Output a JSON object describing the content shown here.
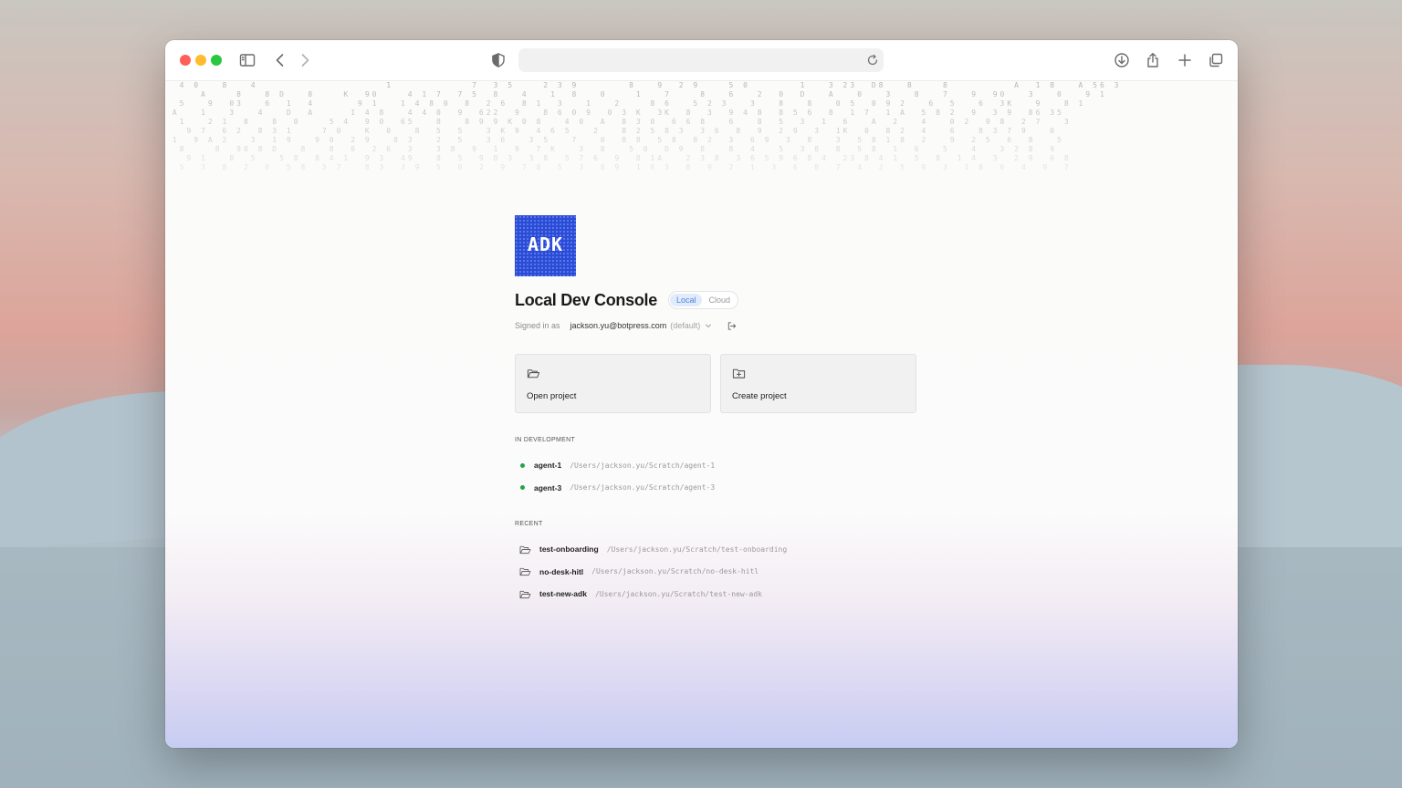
{
  "browser": {
    "url_value": "",
    "url_placeholder": ""
  },
  "background_digits": "  4 0   8   4                  1           7  3 5    2 3 9       8   9  2 9    5 0       1   3 23  D8   8    8         A  1 8   A 56 3\n     A    8   8 D   8    K  90    4 1 7  7 5  8   4   1  8   0    1   7    8   6   2  0  D   A   0   3   8   7   9  90   3   0   9 1\n  5   9  03   6  1  4      9 1   1 4 8 0  8  2 6  8 1  3   1   2    8 6   5 2 3   3   8   8   0 5  0 9 2   6  5   6  3K   9   8 1\n A   1   3   4   D  A     1 4 8   4 4 0  9  622  9   8 6 0 9  0 3 K  3K  8  3  9 4 8  8 5 6  8  1 7  1 A  5 8 2  9  3 9  86 35\n  1   2 1  8   8  0    5 4  9 0  65   8   8 9 9 K 0 8   4 0  A  8 3 0  6 6 8   6   8  5  3  1  6   A  2   4   0 2  9 8  2 7   3\n   9 7  6 2  8 3 1    7 0   K  0   8  5  5   3 K 9  4 6 5   2   8 2 5 8 3  3 6  8  9  2 9  3  1K  0  8 2  4   6   8 3 7 9   0\n 1  9 A 2   3  1 9   9 0  2 9   8 3   2  5   3 6   3 5   7   0  8 8  5 8  8 2  3  6 9  3  8   3  5 8 1 8  2   9  2 5  6  8   5\n  8    8  90 8 D   8   8  0  2 6  3   3 8  9  1  9  7 K   3  8   5 0  D 9  8   8  4   5  3 8  8  5 8  1  6   5   4   3 2 8  9\n   9 1   8  5   5 8  8 4 1  9 3  49   8  5  9 8 3  3 8  5 7 6  9  8 1A   2 3 8  3 6 5 9 6 8 4  23 8 4 1  5  8  1 4  3  2 9  6 8\n  5  3  8  2  0  5 8  5 7   8 3  3 9  5  0  2  9  7 8  5  3  8 9  1 6 3  8  9  2  1  3  6  8  7  4  2  5  9  3  1 8  6  4  9  7",
  "logo": {
    "text": "ADK",
    "bg_color": "#2a4cd6"
  },
  "header": {
    "title": "Local Dev Console",
    "env_options": [
      "Local",
      "Cloud"
    ],
    "env_selected": "Local"
  },
  "account": {
    "signed_in_label": "Signed in as",
    "email": "jackson.yu@botpress.com",
    "tag": "(default)"
  },
  "actions": {
    "open_label": "Open project",
    "create_label": "Create project"
  },
  "in_development": {
    "label": "IN DEVELOPMENT",
    "items": [
      {
        "name": "agent-1",
        "path": "/Users/jackson.yu/Scratch/agent-1"
      },
      {
        "name": "agent-3",
        "path": "/Users/jackson.yu/Scratch/agent-3"
      }
    ],
    "status_color": "#22a447"
  },
  "recent": {
    "label": "RECENT",
    "items": [
      {
        "name": "test-onboarding",
        "path": "/Users/jackson.yu/Scratch/test-onboarding"
      },
      {
        "name": "no-desk-hitl",
        "path": "/Users/jackson.yu/Scratch/no-desk-hitl"
      },
      {
        "name": "test-new-adk",
        "path": "/Users/jackson.yu/Scratch/test-new-adk"
      }
    ]
  },
  "colors": {
    "accent": "#4a86df",
    "accent_bg": "#e1ebfb"
  }
}
